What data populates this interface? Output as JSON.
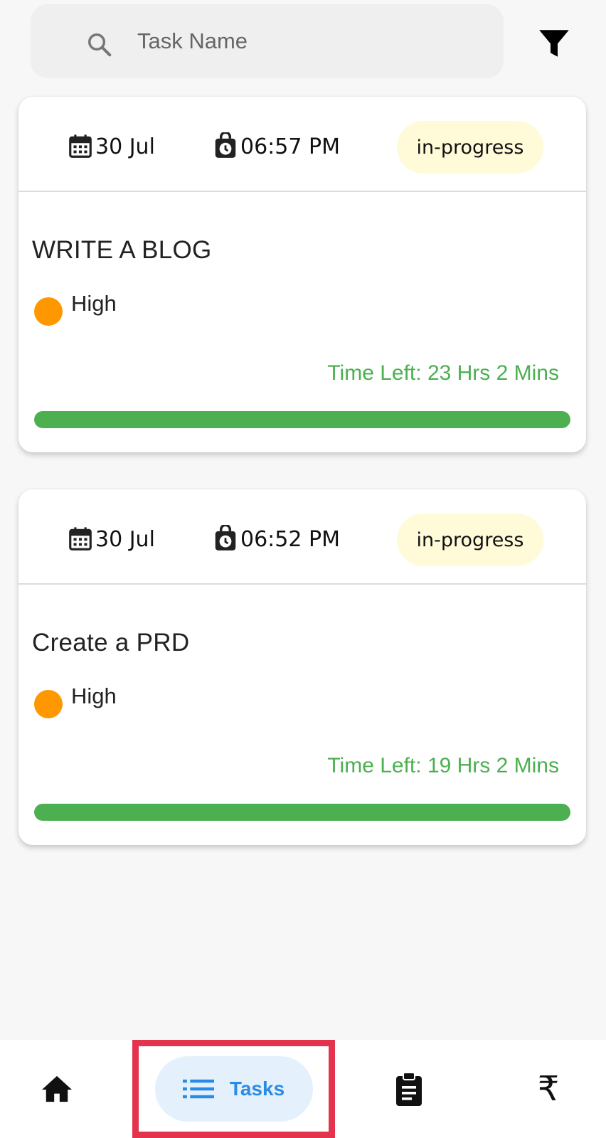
{
  "search": {
    "placeholder": "Task Name",
    "value": ""
  },
  "tasks": [
    {
      "date": "30 Jul",
      "time": "06:57 PM",
      "status": "in-progress",
      "title": "WRITE A BLOG",
      "priority": "High",
      "time_left": "Time Left: 23 Hrs 2 Mins",
      "progress": 1.0
    },
    {
      "date": "30 Jul",
      "time": "06:52 PM",
      "status": "in-progress",
      "title": "Create a PRD",
      "priority": "High",
      "time_left": "Time Left: 19 Hrs 2 Mins",
      "progress": 1.0
    }
  ],
  "nav": {
    "home_icon": "home-icon",
    "tasks_label": "Tasks",
    "reports_icon": "clipboard-icon",
    "money_symbol": "₹"
  },
  "colors": {
    "accent": "#2a8be6",
    "progress": "#4caf50",
    "priority_high": "#ff9800",
    "status_bg": "#fffbd9",
    "highlight": "#e3334d"
  }
}
